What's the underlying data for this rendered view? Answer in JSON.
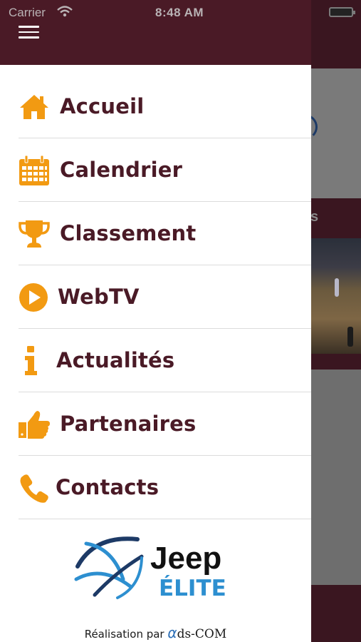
{
  "status_bar": {
    "carrier": "Carrier",
    "time": "8:48 AM"
  },
  "menu": {
    "items": [
      {
        "label": "Accueil",
        "icon": "home-icon"
      },
      {
        "label": "Calendrier",
        "icon": "calendar-icon"
      },
      {
        "label": "Classement",
        "icon": "trophy-icon"
      },
      {
        "label": "WebTV",
        "icon": "play-icon"
      },
      {
        "label": "Actualités",
        "icon": "info-icon"
      },
      {
        "label": "Partenaires",
        "icon": "thumbs-up-icon"
      },
      {
        "label": "Contacts",
        "icon": "phone-icon"
      }
    ]
  },
  "footer": {
    "logo_line1": "Jeep",
    "logo_line2": "ÉLITE",
    "credit_prefix": "Réalisation par",
    "credit_alpha": "α",
    "credit_brand": "ds-COM"
  },
  "colors": {
    "accent": "#f29a12",
    "brand": "#4a1a26",
    "logo_blue": "#2d8fd0"
  }
}
